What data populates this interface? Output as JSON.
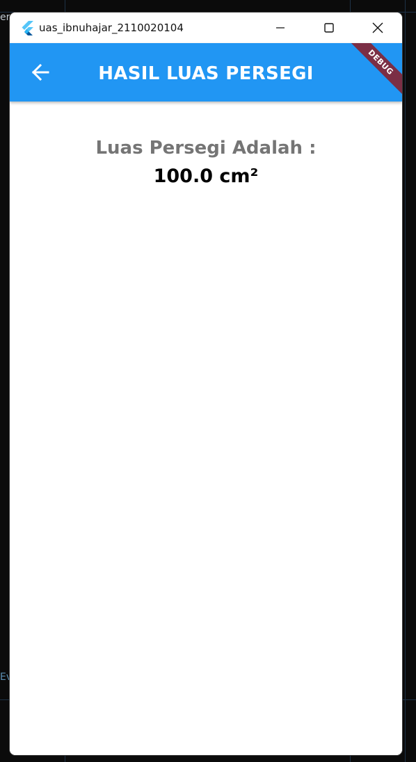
{
  "background": {
    "left_text_top": "er.",
    "left_text_bottom": "Ev"
  },
  "window": {
    "title": "uas_ibnuhajar_2110020104",
    "icon": "flutter-logo-icon"
  },
  "appbar": {
    "title": "HASIL LUAS PERSEGI",
    "back_icon": "arrow-left-icon",
    "color": "#2196f3"
  },
  "debug_banner": {
    "label": "DEBUG",
    "color": "#7b2e45"
  },
  "result": {
    "label": "Luas Persegi Adalah :",
    "value": "100.0 cm²"
  }
}
